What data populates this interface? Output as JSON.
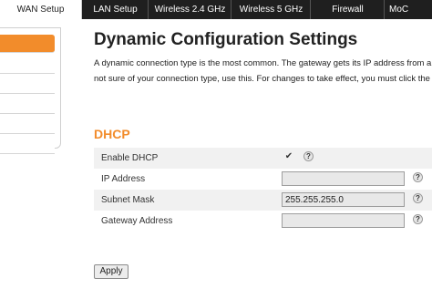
{
  "tabs": [
    {
      "label": "WAN Setup",
      "active": true
    },
    {
      "label": "LAN Setup",
      "active": false
    },
    {
      "label": "Wireless 2.4 GHz",
      "active": false
    },
    {
      "label": "Wireless 5 GHz",
      "active": false
    },
    {
      "label": "Firewall",
      "active": false
    },
    {
      "label": "MoC",
      "active": false
    }
  ],
  "main": {
    "title": "Dynamic Configuration Settings",
    "description_line1": "A dynamic connection type is the most common. The gateway gets its IP address from a",
    "description_line2": "not sure of your connection type, use this. For changes to take effect, you must click the A"
  },
  "dhcp": {
    "section_title": "DHCP",
    "enable_label": "Enable DHCP",
    "enable_checked": true,
    "checkbox_glyph": "✔",
    "help_glyph": "?",
    "ip_label": "IP Address",
    "ip_value": "",
    "subnet_label": "Subnet Mask",
    "subnet_value": "255.255.255.0",
    "gateway_label": "Gateway Address",
    "gateway_value": ""
  },
  "apply_label": "Apply",
  "colors": {
    "accent": "#f28c2b",
    "tabbar": "#1f1f1f"
  }
}
